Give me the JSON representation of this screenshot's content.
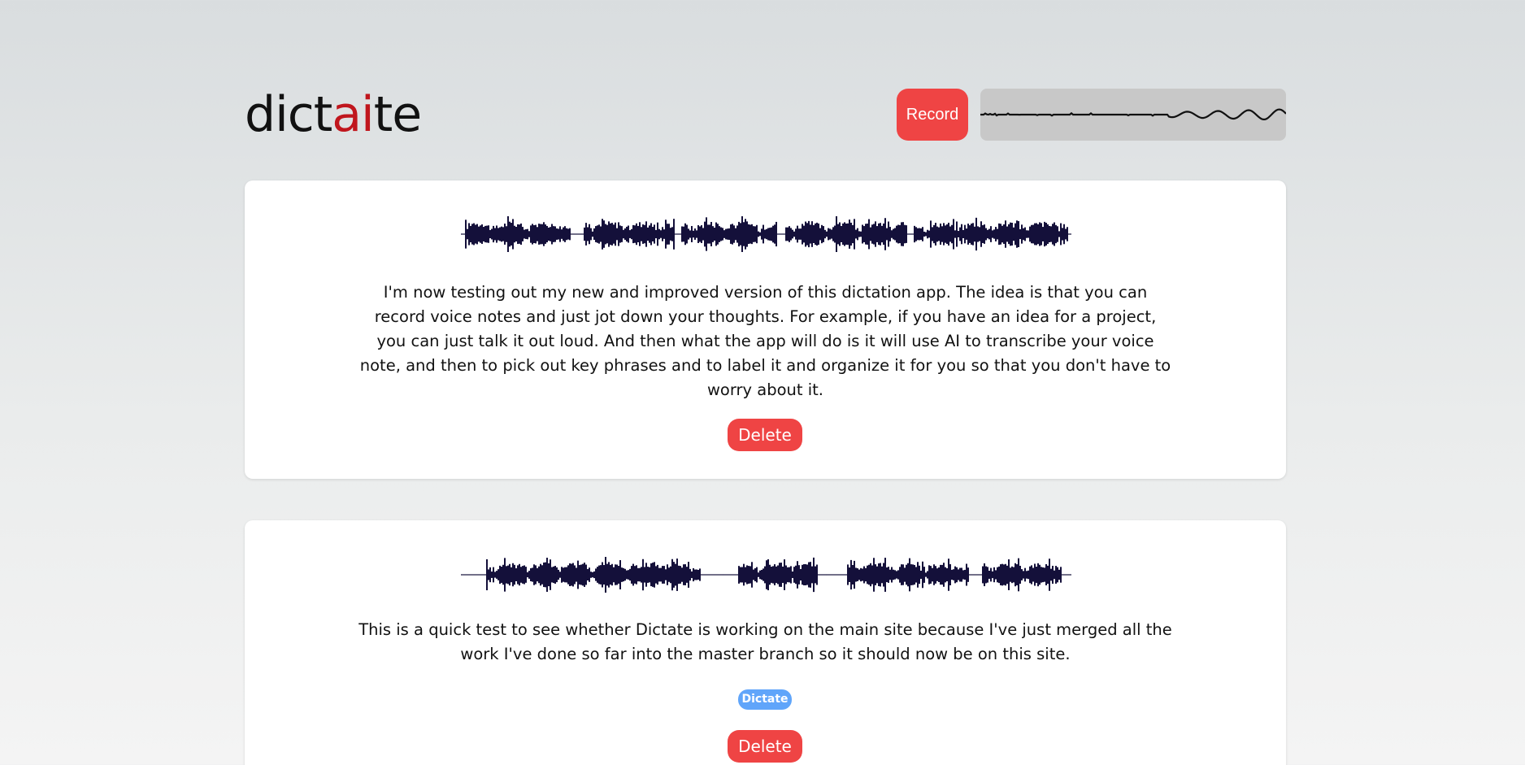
{
  "app": {
    "logo_prefix": "dict",
    "logo_accent": "ai",
    "logo_suffix": "te"
  },
  "header": {
    "record_label": "Record"
  },
  "colors": {
    "accent": "#ef4444",
    "logo_accent": "#c0161d",
    "tag": "#60a5fa",
    "waveform": "#14103a"
  },
  "notes": [
    {
      "transcript": "I'm now testing out my new and improved version of this dictation app. The idea is that you can record voice notes and just jot down your thoughts. For example, if you have an idea for a project, you can just talk it out loud. And then what the app will do is it will use AI to transcribe your voice note, and then to pick out key phrases and to label it and organize it for you so that you don't have to worry about it.",
      "tags": [],
      "delete_label": "Delete"
    },
    {
      "transcript": "This is a quick test to see whether Dictate is working on the main site because I've just merged all the work I've done so far into the master branch so it should now be on this site.",
      "tags": [
        "Dictate"
      ],
      "delete_label": "Delete"
    }
  ]
}
